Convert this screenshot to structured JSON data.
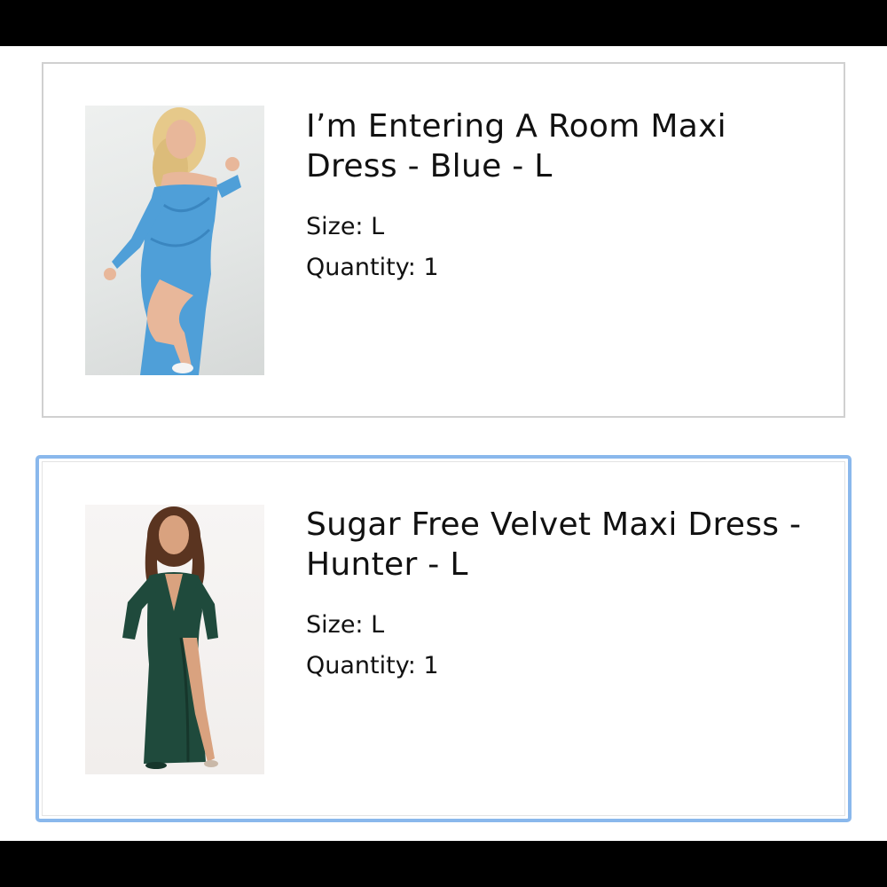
{
  "orders": [
    {
      "title": "I’m Entering A Room Maxi Dress - Blue - L",
      "size_text": "Size: L",
      "quantity_text": "Quantity: 1",
      "image_icon": "product-photo-blue-dress",
      "dress_color": "#4f9fd8"
    },
    {
      "title": "Sugar Free Velvet Maxi Dress - Hunter - L",
      "size_text": "Size: L",
      "quantity_text": "Quantity: 1",
      "image_icon": "product-photo-green-velvet-dress",
      "dress_color": "#1f4a3c"
    }
  ],
  "colors": {
    "selected_border": "#8ab8ec",
    "card_border": "#d0d0d0"
  }
}
